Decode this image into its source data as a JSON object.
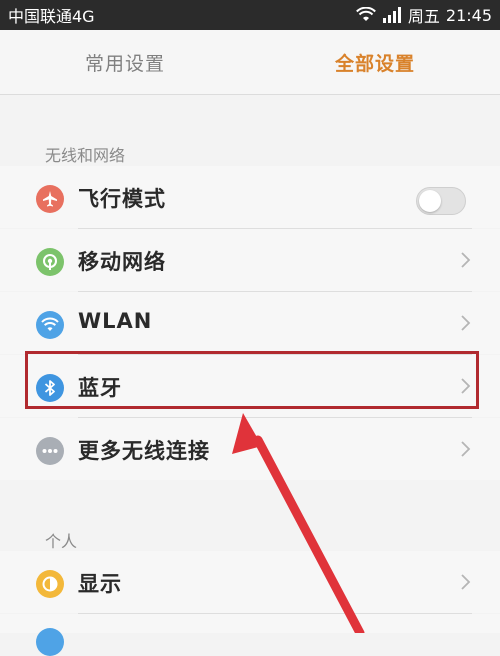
{
  "status_bar": {
    "carrier": "中国联通4G",
    "day": "周五",
    "time": "21:45",
    "icons": [
      "wifi-icon",
      "signal-icon"
    ]
  },
  "tabs": [
    {
      "label": "常用设置",
      "active": false
    },
    {
      "label": "全部设置",
      "active": true
    }
  ],
  "sections": {
    "wireless": {
      "header": "无线和网络"
    },
    "personal": {
      "header": "个人"
    }
  },
  "items": [
    {
      "label": "飞行模式",
      "icon": "airplane-icon",
      "color": "#e8705f",
      "control": "toggle",
      "toggle_on": false
    },
    {
      "label": "移动网络",
      "icon": "mobile-network-icon",
      "color": "#7cc36b",
      "control": "chevron"
    },
    {
      "label": "WLAN",
      "icon": "wifi-icon",
      "color": "#4fa3e6",
      "control": "chevron"
    },
    {
      "label": "蓝牙",
      "icon": "bluetooth-icon",
      "color": "#3f95e0",
      "control": "chevron",
      "highlighted": true
    },
    {
      "label": "更多无线连接",
      "icon": "more-icon",
      "color": "#a9aeb5",
      "control": "chevron"
    },
    {
      "label": "显示",
      "icon": "display-icon",
      "color": "#f3b83a",
      "control": "chevron"
    }
  ],
  "colors": {
    "accent": "#d9822b",
    "annotation_red": "#b12a2f",
    "annotation_arrow": "#e0333a"
  }
}
